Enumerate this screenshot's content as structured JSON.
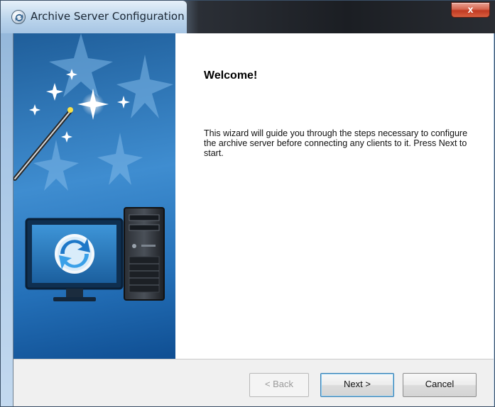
{
  "window": {
    "title": "Archive Server Configuration",
    "close_label": "x",
    "icon": "archive-server-app-icon"
  },
  "banner": {
    "illustration": "computer-sync-with-magic-wand",
    "colors": {
      "background": "#2d7bc4",
      "monitor": "#163d63"
    }
  },
  "page": {
    "heading": "Welcome!",
    "description": "This wizard will guide you through the steps necessary to configure the archive server before connecting any clients to it. Press Next to start."
  },
  "buttons": {
    "back": "< Back",
    "next": "Next >",
    "cancel": "Cancel"
  },
  "state": {
    "back_enabled": false,
    "default_button": "next"
  }
}
